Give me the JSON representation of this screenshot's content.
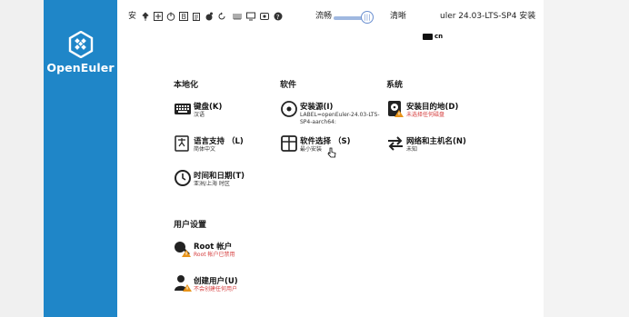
{
  "app": {
    "brand": "OpenEuler",
    "title_prefix": "安",
    "title": "uler 24.03-LTS-SP4 安装"
  },
  "toolbar": {
    "slider_left_label": "流畅",
    "slider_right_label": "清晰",
    "slider_value": 0.7,
    "icons": [
      "pin-icon",
      "fit-screen-icon",
      "power-icon",
      "bold-b-icon",
      "clipboard-icon",
      "mouse-icon",
      "refresh-icon",
      "keyboard-icon",
      "monitor-icon",
      "video-icon",
      "help-icon"
    ]
  },
  "keyboard_layout": {
    "label": "cn"
  },
  "sections": {
    "localization": {
      "title": "本地化",
      "items": [
        {
          "title": "键盘(K)",
          "status": "汉语",
          "icon": "keyboard-icon"
        },
        {
          "title": "语言支持 （L)",
          "status": "简体中文",
          "icon": "language-icon"
        },
        {
          "title": "时间和日期(T)",
          "status": "亚洲/上海 时区",
          "icon": "clock-icon"
        }
      ]
    },
    "software": {
      "title": "软件",
      "items": [
        {
          "title": "安装源(I)",
          "status_line1": "LABEL=openEuler-24.03-LTS-",
          "status_line2": "SP4-aarch64:",
          "icon": "disc-icon"
        },
        {
          "title": "软件选择 （S)",
          "status": "最小安装",
          "icon": "package-icon"
        }
      ]
    },
    "system": {
      "title": "系统",
      "items": [
        {
          "title": "安装目的地(D)",
          "status": "未选择任何磁盘",
          "icon": "disk-warning-icon",
          "warning": true
        },
        {
          "title": "网络和主机名(N)",
          "status": "未知",
          "icon": "network-arrows-icon"
        }
      ]
    },
    "user": {
      "title": "用户设置",
      "items": [
        {
          "title": "Root 帐户",
          "status": "Root 帐户已禁用",
          "icon": "root-key-icon",
          "warning": true
        },
        {
          "title": "创建用户(U)",
          "status": "不会创建任何用户",
          "icon": "user-warning-icon",
          "warning": true
        }
      ]
    }
  },
  "colors": {
    "sidebar": "#1f86c8",
    "warning": "#d53c3c",
    "accent": "#6a8fd0"
  }
}
